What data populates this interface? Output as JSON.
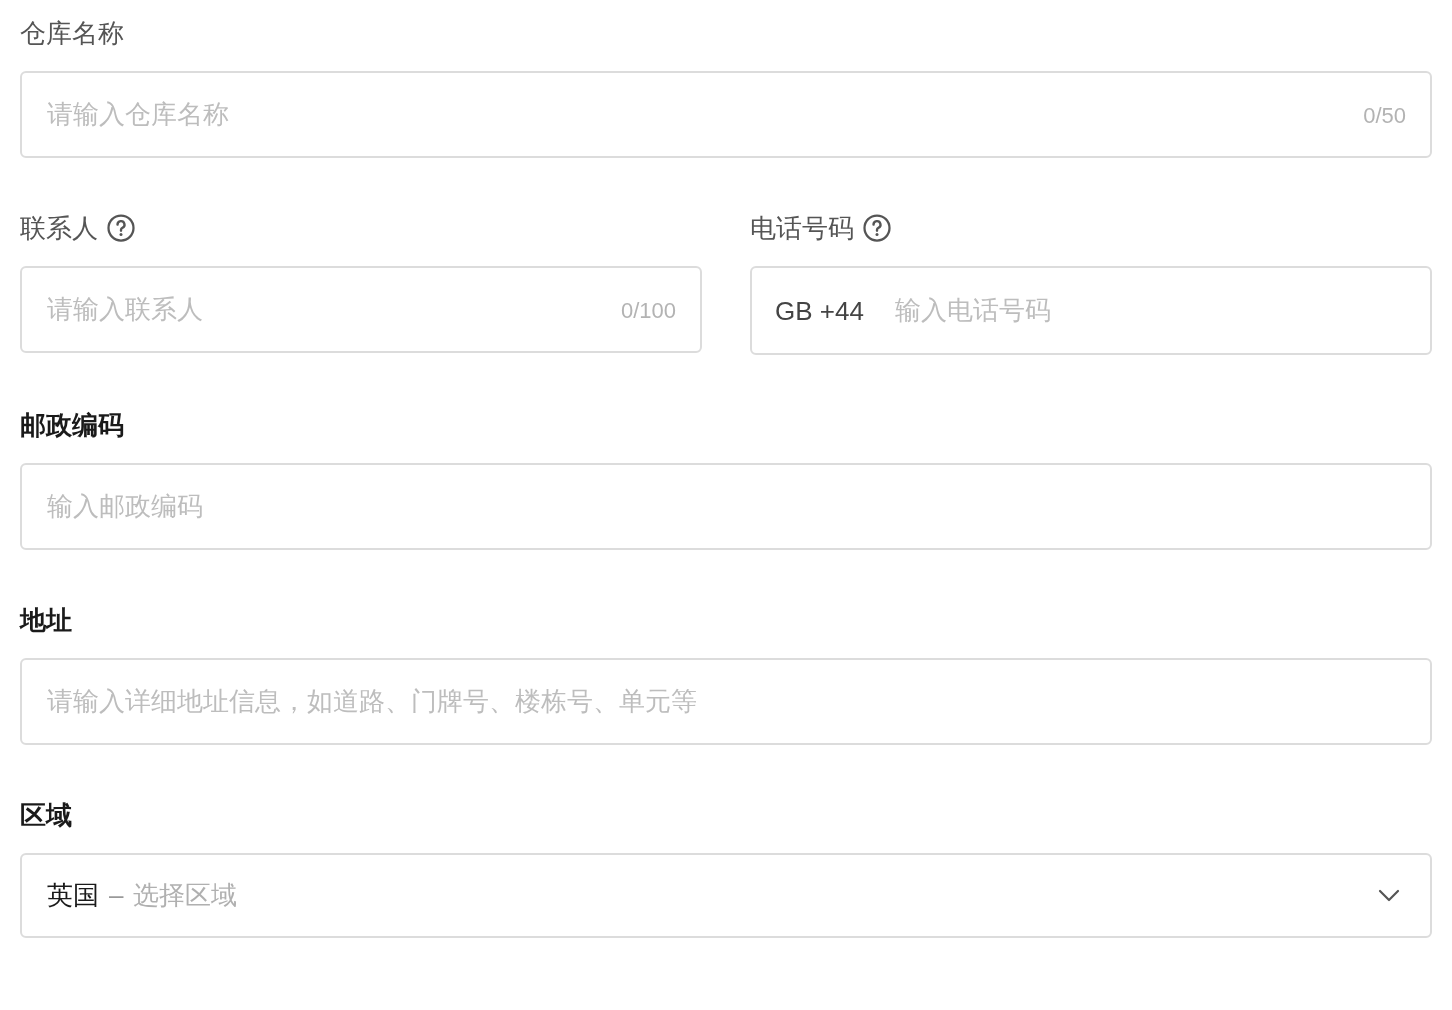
{
  "rows": [
    [
      {
        "kind": "text",
        "label": "仓库名称",
        "dimmed_label": true,
        "help": false,
        "placeholder": "请输入仓库名称",
        "counter": "0/50"
      }
    ],
    [
      {
        "kind": "text",
        "label": "联系人",
        "dimmed_label": true,
        "help": true,
        "placeholder": "请输入联系人",
        "counter": "0/100"
      },
      {
        "kind": "phone",
        "label": "电话号码",
        "dimmed_label": true,
        "help": true,
        "prefix": "GB +44",
        "placeholder": "输入电话号码"
      }
    ],
    [
      {
        "kind": "text",
        "label": "邮政编码",
        "dimmed_label": false,
        "help": false,
        "placeholder": "输入邮政编码"
      }
    ],
    [
      {
        "kind": "text",
        "label": "地址",
        "dimmed_label": false,
        "help": false,
        "placeholder": "请输入详细地址信息，如道路、门牌号、楼栋号、单元等"
      }
    ],
    [
      {
        "kind": "select",
        "label": "区域",
        "dimmed_label": false,
        "help": false,
        "value": "英国",
        "separator": "–",
        "placeholder": "选择区域"
      }
    ]
  ]
}
